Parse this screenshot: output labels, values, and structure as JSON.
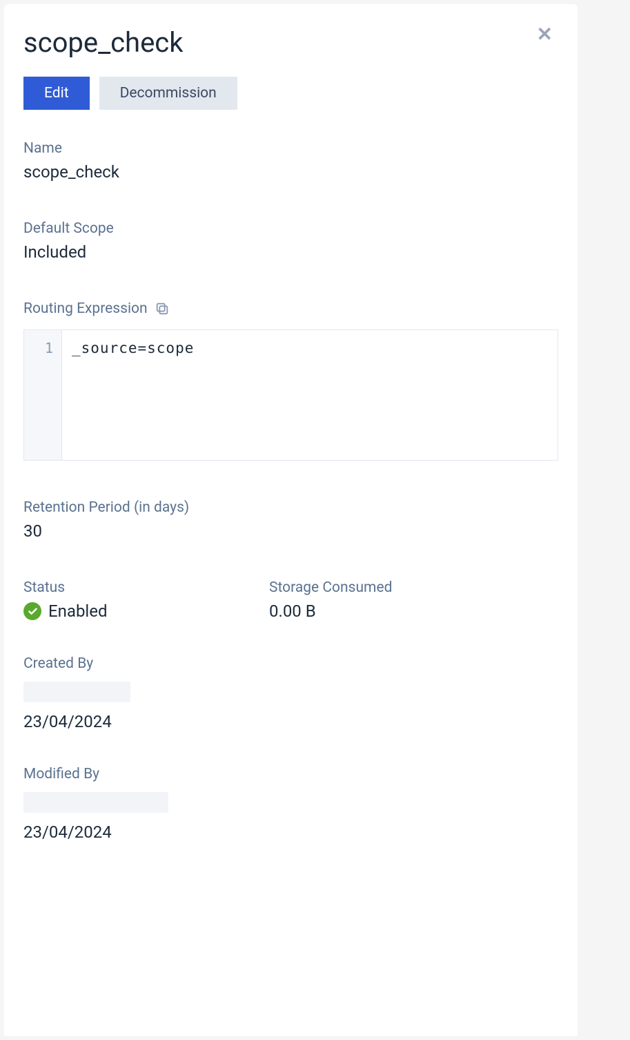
{
  "header": {
    "title": "scope_check"
  },
  "buttons": {
    "edit": "Edit",
    "decommission": "Decommission"
  },
  "fields": {
    "name": {
      "label": "Name",
      "value": "scope_check"
    },
    "default_scope": {
      "label": "Default Scope",
      "value": "Included"
    },
    "routing_expression": {
      "label": "Routing Expression",
      "line_no": "1",
      "code": "_source=scope"
    },
    "retention_period": {
      "label": "Retention Period (in days)",
      "value": "30"
    },
    "status": {
      "label": "Status",
      "value": "Enabled"
    },
    "storage_consumed": {
      "label": "Storage Consumed",
      "value": "0.00 B"
    },
    "created_by": {
      "label": "Created By",
      "user": "",
      "date": "23/04/2024"
    },
    "modified_by": {
      "label": "Modified By",
      "user": "",
      "date": "23/04/2024"
    }
  }
}
